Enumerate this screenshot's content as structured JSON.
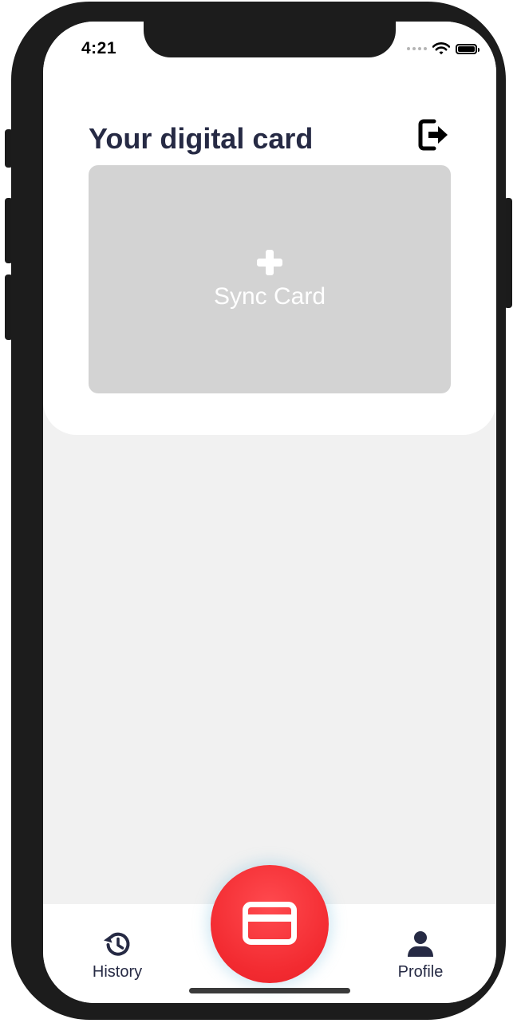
{
  "status_bar": {
    "time": "4:21"
  },
  "header": {
    "title": "Your digital card",
    "logout_icon": "sign-out-icon"
  },
  "card": {
    "action_icon": "plus-icon",
    "action_label": "Sync Card",
    "placeholder_color": "#d3d3d3"
  },
  "tabbar": {
    "items": [
      {
        "label": "History",
        "icon": "history-icon"
      },
      {
        "label": "Profile",
        "icon": "person-icon"
      }
    ],
    "center_button_icon": "credit-card-icon",
    "accent_color": "#f22a30"
  },
  "colors": {
    "title_text": "#262a44",
    "screen_background": "#f1f1f1"
  }
}
